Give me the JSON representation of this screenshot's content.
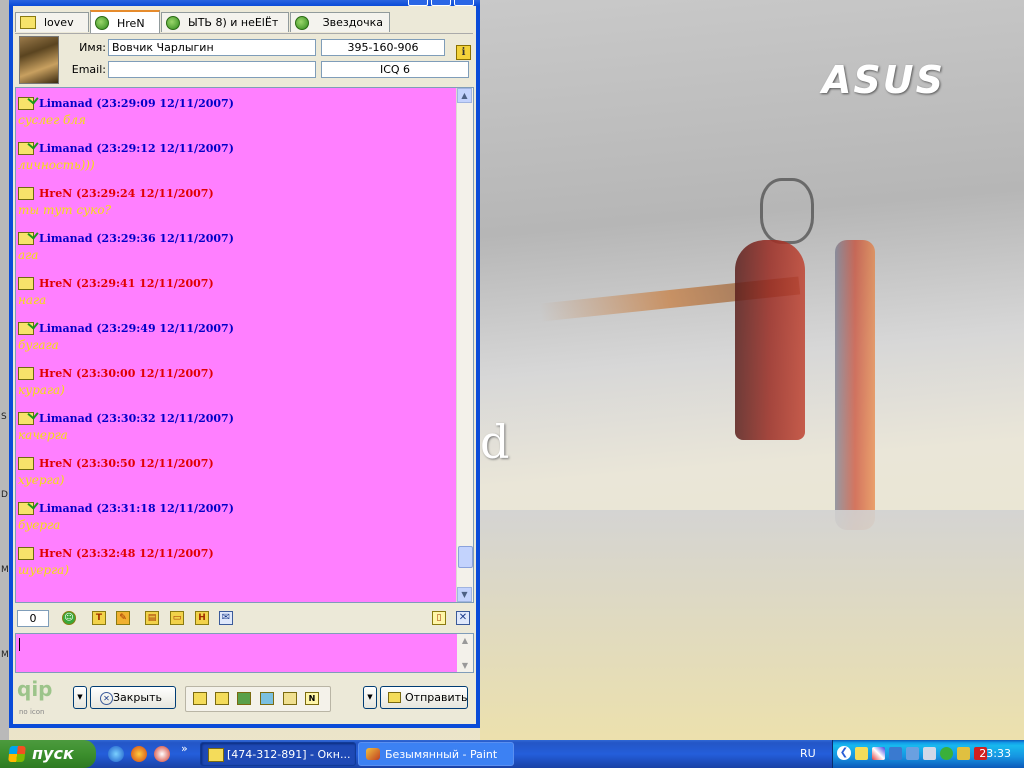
{
  "window": {
    "tabs": [
      {
        "label": "lovev",
        "icon": "message-icon",
        "active": false
      },
      {
        "label": "HreN",
        "icon": "online-flower-icon",
        "active": true
      },
      {
        "label": "ЫТЬ 8) и неЕlЁт",
        "icon": "online-flower-icon",
        "active": false
      },
      {
        "label": "Звездочка",
        "icon": "online-flower-icon",
        "active": false
      }
    ],
    "contact": {
      "name_label": "Имя:",
      "name": "Вовчик  Чарлыгин",
      "email_label": "Email:",
      "email": "",
      "uin": "395-160-906",
      "client": "ICQ 6"
    },
    "messages": [
      {
        "author": "Limanad",
        "time": "(23:29:09 12/11/2007)",
        "text": "суслег бля",
        "dir": "in"
      },
      {
        "author": "Limanad",
        "time": "(23:29:12 12/11/2007)",
        "text": "личность)))",
        "dir": "in"
      },
      {
        "author": "HreN",
        "time": "(23:29:24 12/11/2007)",
        "text": "ты тут суко?",
        "dir": "out"
      },
      {
        "author": "Limanad",
        "time": "(23:29:36 12/11/2007)",
        "text": "ага",
        "dir": "in"
      },
      {
        "author": "HreN",
        "time": "(23:29:41 12/11/2007)",
        "text": "нага",
        "dir": "out"
      },
      {
        "author": "Limanad",
        "time": "(23:29:49 12/11/2007)",
        "text": "бугага",
        "dir": "in"
      },
      {
        "author": "HreN",
        "time": "(23:30:00 12/11/2007)",
        "text": "курага)",
        "dir": "out"
      },
      {
        "author": "Limanad",
        "time": "(23:30:32 12/11/2007)",
        "text": "качерга",
        "dir": "in"
      },
      {
        "author": "HreN",
        "time": "(23:30:50 12/11/2007)",
        "text": "хуерга)",
        "dir": "out"
      },
      {
        "author": "Limanad",
        "time": "(23:31:18 12/11/2007)",
        "text": "буерга",
        "dir": "in"
      },
      {
        "author": "HreN",
        "time": "(23:32:48 12/11/2007)",
        "text": "шуерга)",
        "dir": "out"
      }
    ],
    "toolbar": {
      "counter": "0"
    },
    "buttons": {
      "close": "Закрыть",
      "send": "Отправить"
    },
    "brand": {
      "logo": "qip",
      "sub": "no icon"
    }
  },
  "desktop": {
    "logo": "ASUS",
    "partial_text": "d"
  },
  "taskbar": {
    "start": "пуск",
    "more": "»",
    "items": [
      {
        "label": "[474-312-891] - Окн...",
        "active": true
      },
      {
        "label": "Безымянный - Paint",
        "active": false
      }
    ],
    "language": "RU",
    "clock": "23:33"
  },
  "colors": {
    "chat_bg": "#ff7fff",
    "incoming": "#0000c8",
    "outgoing": "#e00000",
    "message_text": "#f5e010"
  }
}
